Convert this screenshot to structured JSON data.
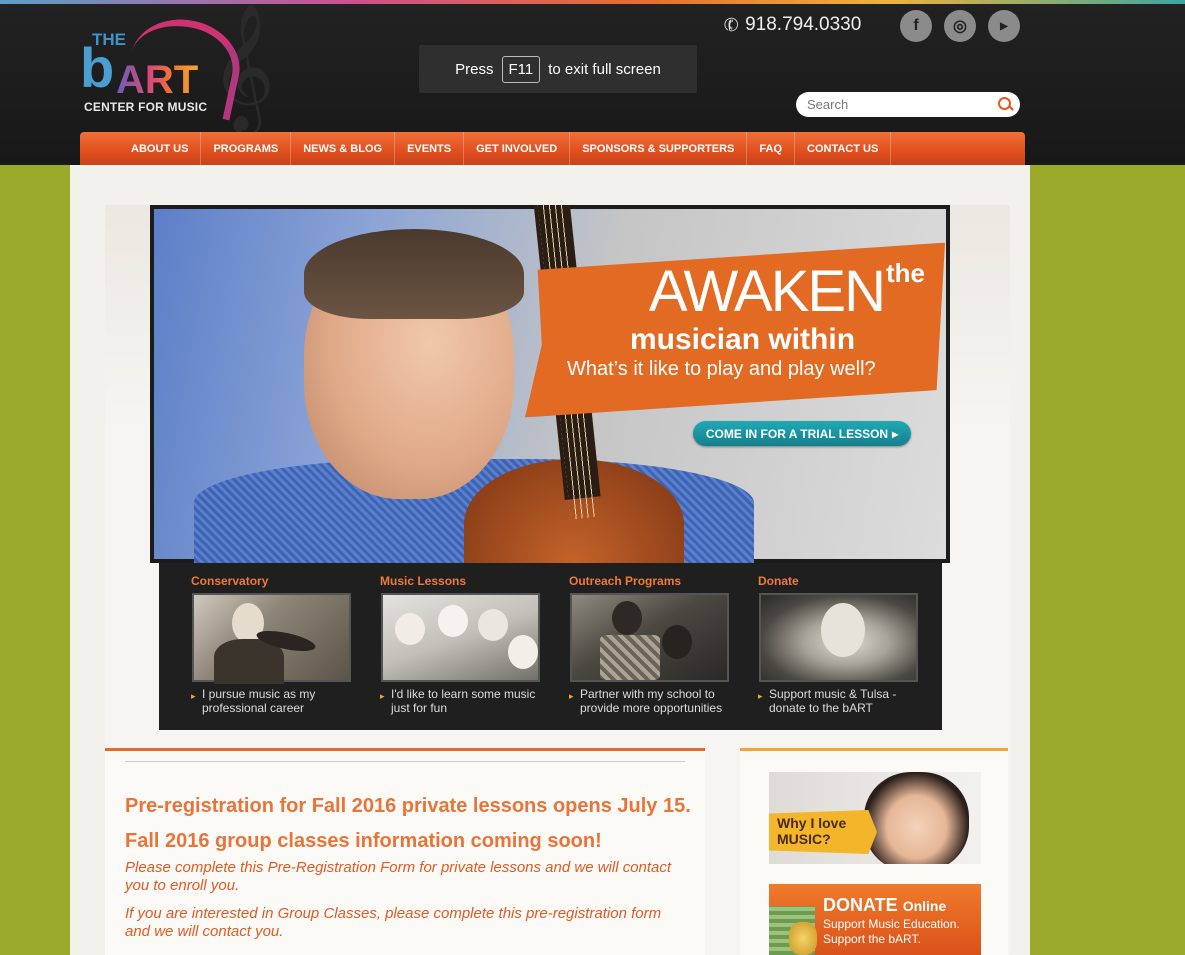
{
  "header": {
    "logo": {
      "the": "THE",
      "b": "b",
      "art": "ART",
      "sub": "CENTER FOR MUSIC"
    },
    "fullscreen_notice": {
      "press": "Press",
      "key": "F11",
      "rest": "to exit full screen"
    },
    "phone": "918.794.0330",
    "social": [
      {
        "name": "facebook",
        "glyph": "f"
      },
      {
        "name": "instagram",
        "glyph": "◎"
      },
      {
        "name": "youtube",
        "glyph": "You\nTube"
      }
    ],
    "search": {
      "placeholder": "Search",
      "value": ""
    }
  },
  "nav": {
    "items": [
      {
        "label": "ABOUT US"
      },
      {
        "label": "PROGRAMS"
      },
      {
        "label": "NEWS & BLOG"
      },
      {
        "label": "EVENTS"
      },
      {
        "label": "GET INVOLVED"
      },
      {
        "label": "SPONSORS & SUPPORTERS"
      },
      {
        "label": "FAQ"
      },
      {
        "label": "CONTACT US"
      }
    ]
  },
  "hero": {
    "headline_big": "AWAKEN",
    "headline_the": "the",
    "line2": "musician within",
    "line3": "What’s it like to play and play well?",
    "cta": "COME IN FOR A TRIAL LESSON",
    "cta_arrow": "▸"
  },
  "cards": [
    {
      "title": "Conservatory",
      "desc": "I pursue music as my professional career"
    },
    {
      "title": "Music Lessons",
      "desc": "I'd like to learn some music just for fun"
    },
    {
      "title": "Outreach Programs",
      "desc": "Partner with my school to provide more opportunities"
    },
    {
      "title": "Donate",
      "desc": "Support music & Tulsa - donate to the bART"
    }
  ],
  "content": {
    "heading": "Pre-registration for Fall 2016 private lessons opens July 15. Fall 2016 group classes information coming soon!",
    "p1": "Please complete this Pre-Registration Form for private lessons and we will contact you to enroll you.",
    "p2": "If you are interested in Group Classes, please complete this pre-registration form and we will contact you."
  },
  "sidebar": {
    "why": {
      "line1": "Why I love",
      "line2": "MUSIC?"
    },
    "donate": {
      "title": "DONATE",
      "title_small": "Online",
      "sub1": "Support Music Education.",
      "sub2": "Support the bART."
    }
  },
  "colors": {
    "accent": "#e2511f",
    "background": "#9aa929",
    "teal": "#1fa9b6",
    "header": "#1c1c1c"
  }
}
